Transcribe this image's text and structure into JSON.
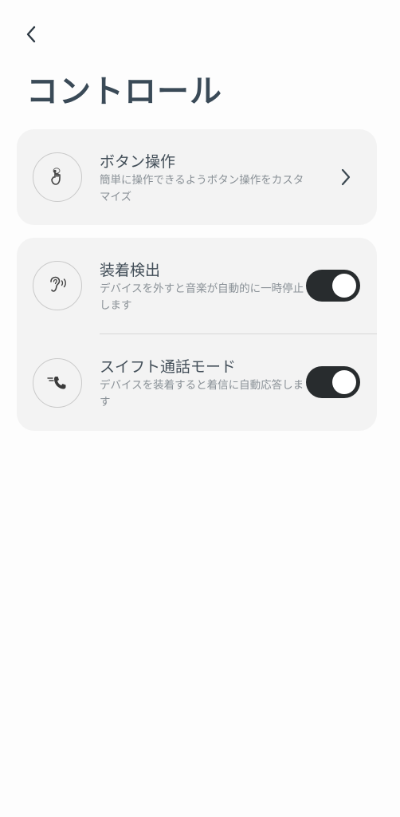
{
  "header": {
    "back_icon": "chevron-left-icon",
    "title": "コントロール"
  },
  "button_controls": {
    "icon": "touch-hand-icon",
    "title": "ボタン操作",
    "description": "簡単に操作できるようボタン操作をカスタマイズ",
    "chevron_icon": "chevron-right-icon"
  },
  "wear_detection": {
    "icon": "ear-detection-icon",
    "title": "装着検出",
    "description": "デバイスを外すと音楽が自動的に一時停止します",
    "enabled": true
  },
  "swift_call_mode": {
    "icon": "incoming-call-icon",
    "title": "スイフト通話モード",
    "description": "デバイスを装着すると着信に自動応答します",
    "enabled": true
  },
  "colors": {
    "background": "#fdfdfd",
    "card": "#f3f3f3",
    "toggle_on": "#282c2e",
    "title_text": "#3a4a57",
    "secondary_text": "#8a9197"
  }
}
